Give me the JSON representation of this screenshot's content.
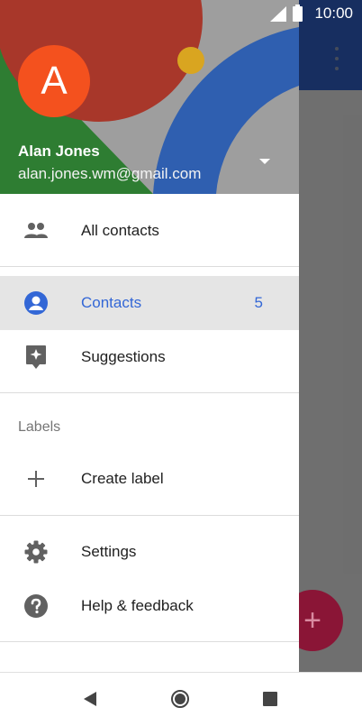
{
  "status_bar": {
    "time": "10:00"
  },
  "account": {
    "initial": "A",
    "name": "Alan Jones",
    "email": "alan.jones.wm@gmail.com"
  },
  "drawer": {
    "all_contacts": "All contacts",
    "contacts": {
      "label": "Contacts",
      "count": "5"
    },
    "suggestions": "Suggestions",
    "labels_heading": "Labels",
    "create_label": "Create label",
    "settings": "Settings",
    "help": "Help & feedback"
  },
  "fab": {
    "icon": "+"
  },
  "colors": {
    "accent": "#3367d6",
    "avatar": "#f4511e",
    "fab": "#8a1536"
  }
}
